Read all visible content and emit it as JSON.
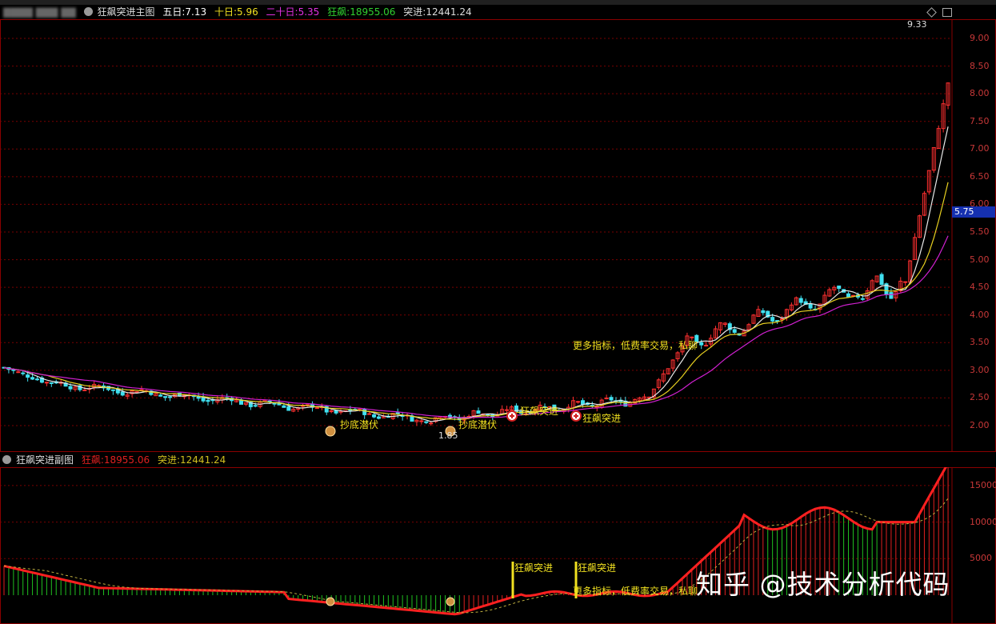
{
  "main_header": {
    "symbol_masked": "▇▇▇▇ ▇▇▇ ▇▇",
    "title": "狂飙突进主图",
    "ma5_label": "五日:",
    "ma5_value": "7.13",
    "ma10_label": "十日:",
    "ma10_value": "5.96",
    "ma20_label": "二十日:",
    "ma20_value": "5.35",
    "kb_label": "狂飙:",
    "kb_value": "18955.06",
    "tj_label": "突进:",
    "tj_value": "12441.24"
  },
  "sub_header": {
    "title": "狂飙突进副图",
    "kb_label": "狂飙:",
    "kb_value": "18955.06",
    "tj_label": "突进:",
    "tj_value": "12441.24"
  },
  "annotations": {
    "max_price": "9.33",
    "min_price": "1.85",
    "current_price": "5.75",
    "signal_1": "抄底潜伏",
    "signal_2": "抄底潜伏",
    "signal_3": "狂飙突进",
    "signal_4": "狂飙突进",
    "promo_main": "更多指标，低费率交易，私聊",
    "sub_signal_1": "狂飙突进",
    "sub_signal_2": "狂飙突进",
    "promo_sub": "更多指标，低费率交易，私聊"
  },
  "price_axis": [
    "9.00",
    "8.50",
    "8.00",
    "7.50",
    "7.00",
    "6.50",
    "6.00",
    "5.50",
    "5.00",
    "4.50",
    "4.00",
    "3.50",
    "3.00",
    "2.50",
    "2.00"
  ],
  "sub_axis": [
    "15000",
    "10000",
    "5000"
  ],
  "watermark": "知乎 @技术分析代码",
  "colors": {
    "up": "#ff3030",
    "down": "#40e0f0",
    "ma5": "#e8e8e8",
    "ma10": "#e8d020",
    "ma20": "#d020d0",
    "grid": "#7a0000",
    "signal": "#f0e020"
  },
  "icons": {
    "gear": "gear-icon",
    "diamond": "diamond-icon",
    "panel": "panel-icon",
    "moneybag": "moneybag-icon",
    "buy": "buy-marker-icon"
  }
}
